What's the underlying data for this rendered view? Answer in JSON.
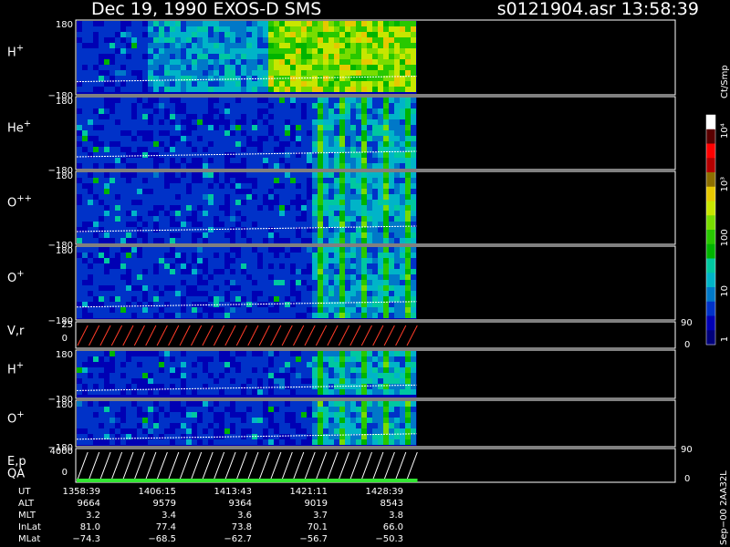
{
  "header": {
    "title": "Dec 19, 1990    EXOS-D SMS",
    "file_time": "s0121904.asr  13:58:39"
  },
  "chart_data": [
    {
      "type": "heatmap",
      "name": "H+ pitch-angle spectrogram",
      "ylabel": "H+",
      "yticks": [
        "180",
        "−180"
      ],
      "ylim": [
        -180,
        180
      ],
      "data_extent_fraction": 0.5
    },
    {
      "type": "heatmap",
      "name": "He+ pitch-angle spectrogram",
      "ylabel": "He+",
      "yticks": [
        "180",
        "−180"
      ],
      "ylim": [
        -180,
        180
      ],
      "data_extent_fraction": 0.5
    },
    {
      "type": "heatmap",
      "name": "O++ pitch-angle spectrogram",
      "ylabel": "O++",
      "yticks": [
        "180",
        "−180"
      ],
      "ylim": [
        -180,
        180
      ],
      "data_extent_fraction": 0.5
    },
    {
      "type": "heatmap",
      "name": "O+ pitch-angle spectrogram",
      "ylabel": "O+",
      "yticks": [
        "180",
        "−180"
      ],
      "ylim": [
        -180,
        180
      ],
      "data_extent_fraction": 0.5
    },
    {
      "type": "line",
      "name": "V,r sawtooth",
      "ylabel": "V,r",
      "yticks_left": [
        "25",
        "0"
      ],
      "yticks_right": [
        "90",
        "0"
      ],
      "ylim": [
        0,
        25
      ],
      "sawtooth_cycles": 30,
      "data_extent_fraction": 0.5
    },
    {
      "type": "heatmap",
      "name": "H+ spectrogram (mode 2)",
      "ylabel": "H+",
      "yticks": [
        "180",
        "−180"
      ],
      "ylim": [
        -180,
        180
      ],
      "data_extent_fraction": 0.5
    },
    {
      "type": "heatmap",
      "name": "O+ spectrogram (mode 2)",
      "ylabel": "O+",
      "yticks": [
        "180",
        "−180"
      ],
      "ylim": [
        -180,
        180
      ],
      "data_extent_fraction": 0.5
    },
    {
      "type": "line",
      "name": "E,p / QA",
      "ylabel": "E,p",
      "ylabel2": "QA",
      "yticks_left": [
        "4000",
        "0"
      ],
      "yticks_right": [
        "90",
        "0"
      ],
      "ylim": [
        0,
        4000
      ],
      "sawtooth_cycles": 30,
      "data_extent_fraction": 0.5
    }
  ],
  "colorbar": {
    "units": "Ct/Smp",
    "ticks": [
      "10⁴",
      "10³",
      "100",
      "10",
      "1"
    ],
    "tick_values": [
      10000,
      1000,
      100,
      10,
      1
    ],
    "colors": [
      "#00007a",
      "#0000b4",
      "#0032c8",
      "#0078c8",
      "#00b4c8",
      "#00c8a0",
      "#00b400",
      "#28c800",
      "#78dc00",
      "#c8e600",
      "#e6c800",
      "#8c6e00",
      "#b40000",
      "#ff0000",
      "#5a0000",
      "#ffffff"
    ]
  },
  "ephemeris": {
    "labels": [
      "UT",
      "ALT",
      "MLT",
      "InLat",
      "MLat"
    ],
    "columns": [
      {
        "UT": "1358:39",
        "ALT": "9664",
        "MLT": "3.2",
        "InLat": "81.0",
        "MLat": "−74.3"
      },
      {
        "UT": "1406:15",
        "ALT": "9579",
        "MLT": "3.4",
        "InLat": "77.4",
        "MLat": "−68.5"
      },
      {
        "UT": "1413:43",
        "ALT": "9364",
        "MLT": "3.6",
        "InLat": "73.8",
        "MLat": "−62.7"
      },
      {
        "UT": "1421:11",
        "ALT": "9019",
        "MLT": "3.7",
        "InLat": "70.1",
        "MLat": "−56.7"
      },
      {
        "UT": "1428:39",
        "ALT": "8543",
        "MLT": "3.8",
        "InLat": "66.0",
        "MLat": "−50.3"
      }
    ]
  },
  "footer": {
    "id": "Sep−00 2AA32L"
  }
}
